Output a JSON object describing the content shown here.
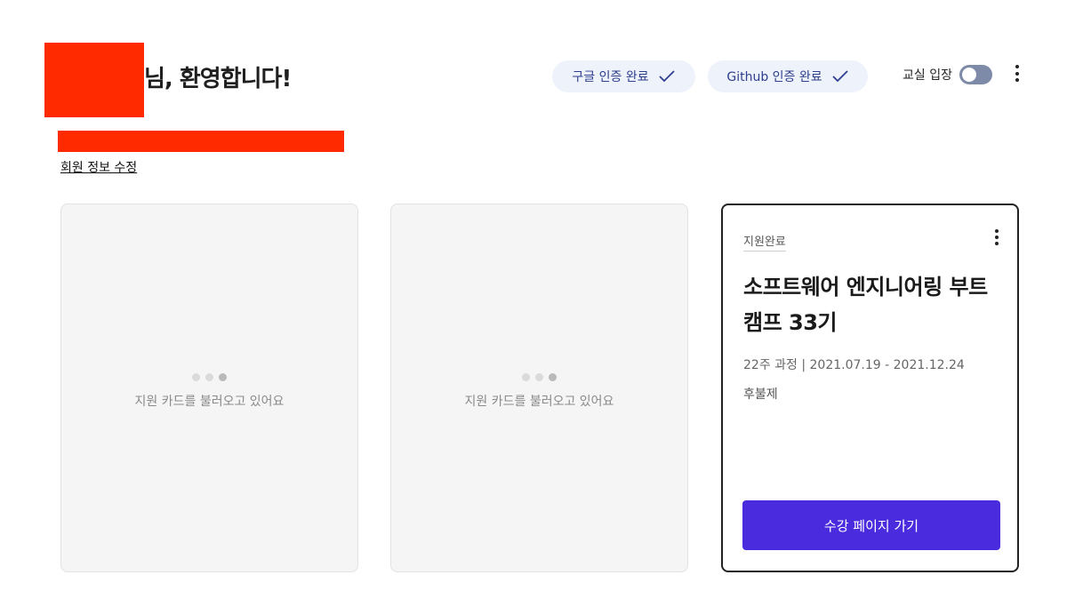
{
  "header": {
    "greeting": "님, 환영합니다!",
    "edit_profile": "회원 정보 수정",
    "auth_badges": [
      {
        "label": "구글 인증 완료",
        "icon": "check-icon"
      },
      {
        "label": "Github 인증 완료",
        "icon": "check-icon"
      }
    ],
    "classroom_toggle": {
      "label": "교실 입장",
      "on": false
    },
    "more_icon": "kebab-icon"
  },
  "cards": {
    "loading_text": "지원 카드를 불러오고 있어요",
    "course": {
      "status": "지원완료",
      "title": "소프트웨어 엔지니어링 부트캠프 33기",
      "period": "22주 과정 | 2021.07.19 - 2021.12.24",
      "payment": "후불제",
      "button": "수강 페이지 가기"
    }
  },
  "colors": {
    "accent": "#4a2bde",
    "badge_bg": "#eef2fb",
    "badge_text": "#2e3f8f",
    "redaction": "#ff2a00"
  }
}
